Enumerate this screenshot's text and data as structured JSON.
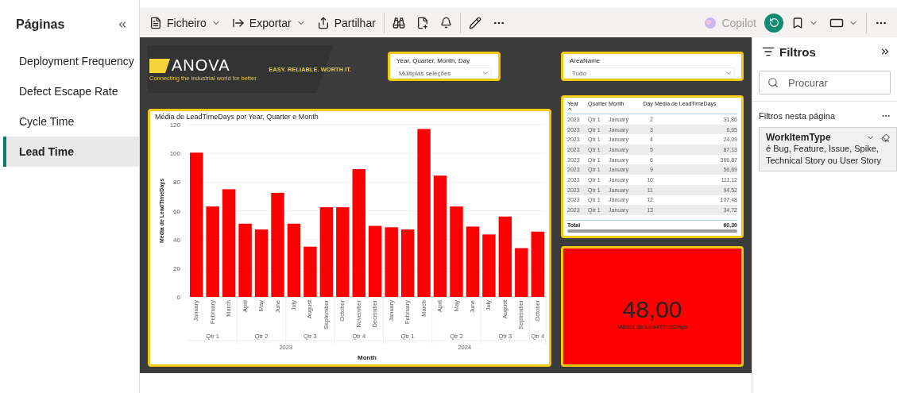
{
  "sidebar": {
    "title": "Páginas",
    "pages": [
      {
        "label": "Deployment Frequency",
        "selected": false
      },
      {
        "label": "Defect Escape Rate",
        "selected": false
      },
      {
        "label": "Cycle Time",
        "selected": false
      },
      {
        "label": "Lead Time",
        "selected": true
      }
    ]
  },
  "toolbar": {
    "menus": [
      {
        "label": "Ficheiro",
        "kind": "file"
      },
      {
        "label": "Exportar",
        "kind": "export"
      }
    ],
    "share": "Partilhar",
    "copilot": {
      "label": "Copilot",
      "disabled": true
    }
  },
  "logo": {
    "name": "ANOVA",
    "tagline": "Connecting the industrial world for better.",
    "slogan": "EASY. RELIABLE. WORTH IT."
  },
  "slicers": [
    {
      "title": "Year, Quarter, Month, Day",
      "value": "Múltiplas seleções"
    },
    {
      "title": "AreaName",
      "value": "Tudo"
    }
  ],
  "chart": {
    "title": "Média de LeadTimeDays por Year, Quarter e Month",
    "years": [
      {
        "label": "2023",
        "quarters": [
          "Qtr 1",
          "Qtr 2",
          "Qtr 3",
          "Qtr 4"
        ]
      },
      {
        "label": "2024",
        "quarters": [
          "Qtr 1",
          "Qtr 2",
          "Qtr 3",
          "Qtr 4"
        ]
      }
    ],
    "chart_data": {
      "type": "bar",
      "grid": true,
      "xlabel": "Month",
      "ylabel": "Média de LeadTimeDays",
      "ylim": [
        0,
        120
      ],
      "yticks": [
        0,
        20,
        40,
        60,
        80,
        100,
        120
      ],
      "categories": [
        "January",
        "February",
        "March",
        "April",
        "May",
        "June",
        "July",
        "August",
        "September",
        "October",
        "November",
        "December",
        "January",
        "February",
        "March",
        "April",
        "May",
        "June",
        "July",
        "August",
        "September",
        "October"
      ],
      "series": [
        {
          "color": "#ff0000",
          "values": [
            100.5,
            63,
            75,
            51,
            47,
            72.5,
            51,
            35,
            62.5,
            62.5,
            89,
            49.5,
            48.5,
            47,
            117,
            84.5,
            63,
            49,
            43.5,
            56,
            34,
            45.5
          ]
        }
      ]
    }
  },
  "table": {
    "columns": [
      {
        "label": "Year",
        "sorted": true
      },
      {
        "label": "Quarter",
        "sorted": false
      },
      {
        "label": "Month",
        "sorted": false
      },
      {
        "label": "Day",
        "sorted": false
      },
      {
        "label": "Média de LeadTimeDays",
        "sorted": false
      }
    ],
    "rows": [
      [
        "2023",
        "Qtr 1",
        "January",
        "2",
        "31,86"
      ],
      [
        "2023",
        "Qtr 1",
        "January",
        "3",
        "6,65"
      ],
      [
        "2023",
        "Qtr 1",
        "January",
        "4",
        "24,09"
      ],
      [
        "2023",
        "Qtr 1",
        "January",
        "5",
        "87,13"
      ],
      [
        "2023",
        "Qtr 1",
        "January",
        "6",
        "366,87"
      ],
      [
        "2023",
        "Qtr 1",
        "January",
        "9",
        "56,69"
      ],
      [
        "2023",
        "Qtr 1",
        "January",
        "10",
        "111,12"
      ],
      [
        "2023",
        "Qtr 1",
        "January",
        "11",
        "94,52"
      ],
      [
        "2023",
        "Qtr 1",
        "January",
        "12",
        "107,48"
      ],
      [
        "2023",
        "Qtr 1",
        "January",
        "13",
        "34,72"
      ]
    ],
    "total_label": "Total",
    "total_value": "60,30"
  },
  "card": {
    "value": "48,00",
    "label": "Média de LeadTimeDays"
  },
  "filters": {
    "title": "Filtros",
    "search_placeholder": "Procurar",
    "section": "Filtros nesta página",
    "items": [
      {
        "field": "WorkItemType",
        "description": "é Bug, Feature, Issue, Spike, Technical Story ou User Story"
      }
    ]
  }
}
